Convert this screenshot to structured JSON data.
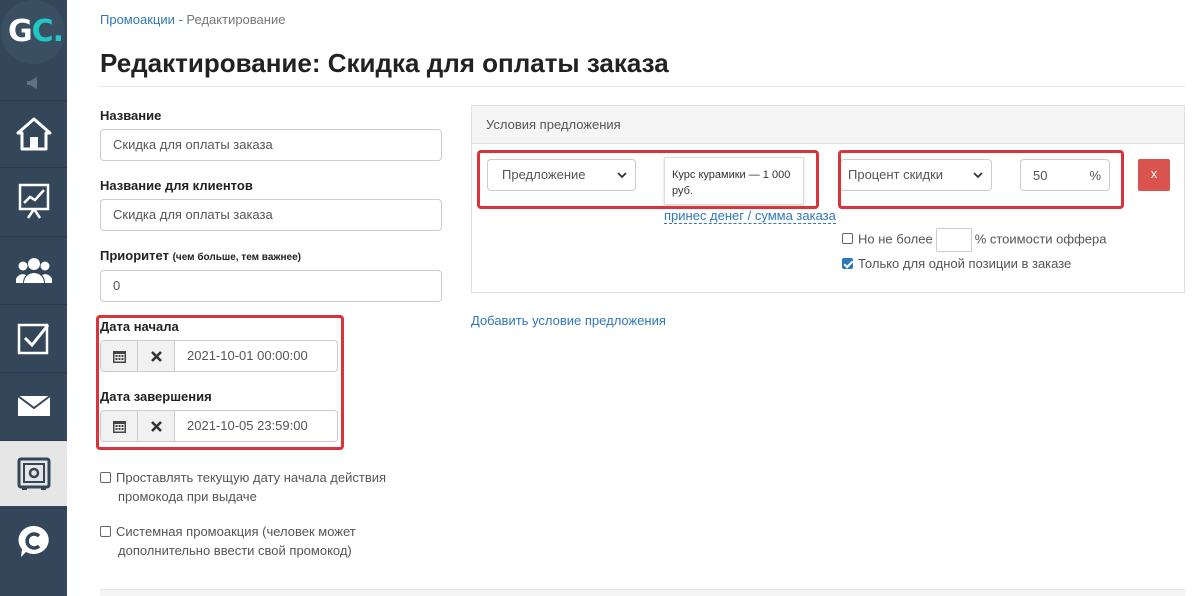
{
  "sidebar": {
    "logo_g": "G",
    "logo_c": "C.",
    "items": [
      {
        "icon": "home-icon"
      },
      {
        "icon": "chart-board-icon"
      },
      {
        "icon": "users-icon"
      },
      {
        "icon": "checkbox-icon"
      },
      {
        "icon": "mail-icon"
      },
      {
        "icon": "safe-icon",
        "active": true
      },
      {
        "icon": "chat-icon"
      }
    ]
  },
  "breadcrumb": {
    "parent": "Промоакции",
    "separator": " - ",
    "current": "Редактирование"
  },
  "page_title": "Редактирование: Скидка для оплаты заказа",
  "form": {
    "name_label": "Название",
    "name_value": "Скидка для оплаты заказа",
    "client_name_label": "Название для клиентов",
    "client_name_value": "Скидка для оплаты заказа",
    "priority_label": "Приоритет",
    "priority_hint": "(чем больше, тем важнее)",
    "priority_value": "0",
    "start_label": "Дата начала",
    "start_value": "2021-10-01 00:00:00",
    "end_label": "Дата завершения",
    "end_value": "2021-10-05 23:59:00",
    "check_current_date": "Проставлять текущую дату начала действия промокода при выдаче",
    "check_current_date_line1": "Проставлять текущую дату начала действия",
    "check_current_date_line2": "промокода при выдаче",
    "check_system_line1": "Системная промоакция (человек может",
    "check_system_line2": "дополнительно ввести свой промокод)"
  },
  "conditions": {
    "title": "Условия предложения",
    "offer_select": "Предложение",
    "tooltip_line1": "Курс курамики — 1 000",
    "tooltip_line2": "руб.",
    "dotted_link": "принес денег / сумма заказа",
    "discount_select": "Процент скидки",
    "percent_value": "50",
    "percent_unit": "%",
    "delete_label": "x",
    "no_more_prefix": "Но не более",
    "no_more_suffix": "% стоимости оффера",
    "single_position": "Только для одной позиции в заказе"
  },
  "add_condition_link": "Добавить условие предложения",
  "colors": {
    "sidebar": "#34465a",
    "link": "#2f78b7",
    "highlight": "#d9343b",
    "delete": "#d9534f"
  }
}
